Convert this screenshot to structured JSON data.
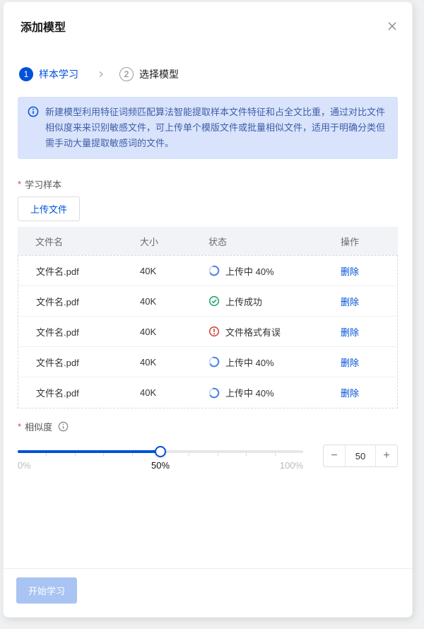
{
  "dialog": {
    "title": "添加模型"
  },
  "steps": {
    "step1": {
      "num": "1",
      "label": "样本学习"
    },
    "step2": {
      "num": "2",
      "label": "选择模型"
    }
  },
  "info_banner": {
    "text": "新建模型利用特征词频匹配算法智能提取样本文件特征和占全文比重，通过对比文件相似度来来识别敏感文件，可上传单个模版文件或批量相似文件，适用于明确分类但需手动大量提取敏感词的文件。"
  },
  "sample_section": {
    "required_mark": "*",
    "label": "学习样本",
    "upload_button": "上传文件",
    "table": {
      "headers": [
        "文件名",
        "大小",
        "状态",
        "操作"
      ],
      "rows": [
        {
          "name": "文件名.pdf",
          "size": "40K",
          "status": "上传中 40%",
          "status_type": "loading",
          "action": "删除"
        },
        {
          "name": "文件名.pdf",
          "size": "40K",
          "status": "上传成功",
          "status_type": "success",
          "action": "删除"
        },
        {
          "name": "文件名.pdf",
          "size": "40K",
          "status": "文件格式有误",
          "status_type": "error",
          "action": "删除"
        },
        {
          "name": "文件名.pdf",
          "size": "40K",
          "status": "上传中 40%",
          "status_type": "loading",
          "action": "删除"
        },
        {
          "name": "文件名.pdf",
          "size": "40K",
          "status": "上传中 40%",
          "status_type": "loading",
          "action": "删除"
        }
      ]
    }
  },
  "similarity_section": {
    "required_mark": "*",
    "label": "相似度",
    "slider": {
      "value": 50,
      "min_label": "0%",
      "mid_label": "50%",
      "max_label": "100%"
    },
    "stepper": {
      "minus": "−",
      "value": "50",
      "plus": "+"
    }
  },
  "footer": {
    "submit_button": "开始学习"
  },
  "colors": {
    "primary": "#0052d9",
    "banner_bg": "#d9e3fb",
    "banner_text": "#3d5fa9",
    "success": "#2ba471",
    "error": "#d54941",
    "disabled_button_bg": "#a9c4f2"
  }
}
